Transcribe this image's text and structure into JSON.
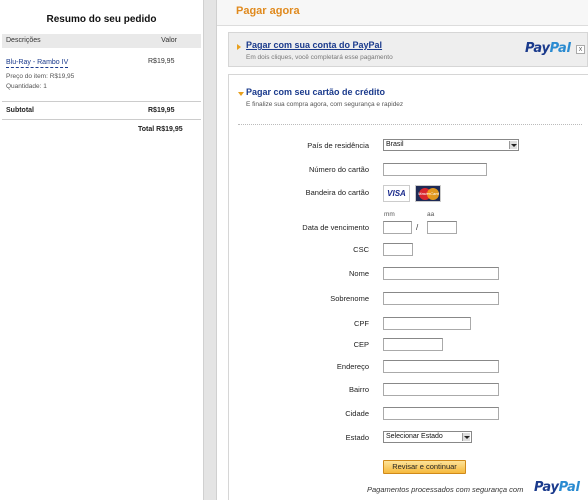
{
  "summary": {
    "title": "Resumo do seu pedido",
    "col_desc": "Descrições",
    "col_value": "Valor",
    "item_name": "Blu-Ray - Rambo IV",
    "item_price": "R$19,95",
    "unit_price": "Preço do item: R$19,95",
    "quantity": "Quantidade: 1",
    "subtotal_label": "Subtotal",
    "subtotal_value": "R$19,95",
    "total": "Total R$19,95"
  },
  "header": {
    "title": "Pagar agora"
  },
  "paypal_option": {
    "link": "Pagar com sua conta do PayPal",
    "desc": "Em dois cliques, você completará esse pagamento",
    "logo_a": "Pay",
    "logo_b": "Pal",
    "close": "x"
  },
  "card_option": {
    "title": "Pagar com seu cartão de crédito",
    "desc": "E finalize sua compra agora, com segurança e rapidez"
  },
  "form": {
    "country_label": "País de residência",
    "country_value": "Brasil",
    "card_number_label": "Número do cartão",
    "card_brand_label": "Bandeira do cartão",
    "visa": "VISA",
    "mastercard": "MasterCard",
    "mm": "mm",
    "aa": "aa",
    "slash": "/",
    "expiry_label": "Data de vencimento",
    "csc_label": "CSC",
    "name_label": "Nome",
    "surname_label": "Sobrenome",
    "cpf_label": "CPF",
    "cep_label": "CEP",
    "address_label": "Endereço",
    "district_label": "Bairro",
    "city_label": "Cidade",
    "state_label": "Estado",
    "state_value": "Selecionar Estado",
    "submit": "Revisar e continuar"
  },
  "footer": {
    "text": "Pagamentos processados com segurança com",
    "logo_a": "Pay",
    "logo_b": "Pal"
  }
}
